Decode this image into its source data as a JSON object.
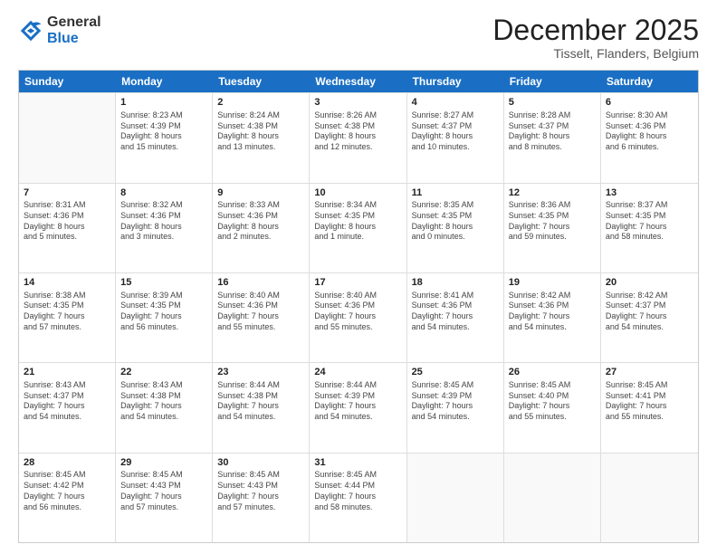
{
  "logo": {
    "general": "General",
    "blue": "Blue"
  },
  "header": {
    "month": "December 2025",
    "location": "Tisselt, Flanders, Belgium"
  },
  "days": [
    "Sunday",
    "Monday",
    "Tuesday",
    "Wednesday",
    "Thursday",
    "Friday",
    "Saturday"
  ],
  "weeks": [
    [
      {
        "day": "",
        "info": ""
      },
      {
        "day": "1",
        "info": "Sunrise: 8:23 AM\nSunset: 4:39 PM\nDaylight: 8 hours\nand 15 minutes."
      },
      {
        "day": "2",
        "info": "Sunrise: 8:24 AM\nSunset: 4:38 PM\nDaylight: 8 hours\nand 13 minutes."
      },
      {
        "day": "3",
        "info": "Sunrise: 8:26 AM\nSunset: 4:38 PM\nDaylight: 8 hours\nand 12 minutes."
      },
      {
        "day": "4",
        "info": "Sunrise: 8:27 AM\nSunset: 4:37 PM\nDaylight: 8 hours\nand 10 minutes."
      },
      {
        "day": "5",
        "info": "Sunrise: 8:28 AM\nSunset: 4:37 PM\nDaylight: 8 hours\nand 8 minutes."
      },
      {
        "day": "6",
        "info": "Sunrise: 8:30 AM\nSunset: 4:36 PM\nDaylight: 8 hours\nand 6 minutes."
      }
    ],
    [
      {
        "day": "7",
        "info": "Sunrise: 8:31 AM\nSunset: 4:36 PM\nDaylight: 8 hours\nand 5 minutes."
      },
      {
        "day": "8",
        "info": "Sunrise: 8:32 AM\nSunset: 4:36 PM\nDaylight: 8 hours\nand 3 minutes."
      },
      {
        "day": "9",
        "info": "Sunrise: 8:33 AM\nSunset: 4:36 PM\nDaylight: 8 hours\nand 2 minutes."
      },
      {
        "day": "10",
        "info": "Sunrise: 8:34 AM\nSunset: 4:35 PM\nDaylight: 8 hours\nand 1 minute."
      },
      {
        "day": "11",
        "info": "Sunrise: 8:35 AM\nSunset: 4:35 PM\nDaylight: 8 hours\nand 0 minutes."
      },
      {
        "day": "12",
        "info": "Sunrise: 8:36 AM\nSunset: 4:35 PM\nDaylight: 7 hours\nand 59 minutes."
      },
      {
        "day": "13",
        "info": "Sunrise: 8:37 AM\nSunset: 4:35 PM\nDaylight: 7 hours\nand 58 minutes."
      }
    ],
    [
      {
        "day": "14",
        "info": "Sunrise: 8:38 AM\nSunset: 4:35 PM\nDaylight: 7 hours\nand 57 minutes."
      },
      {
        "day": "15",
        "info": "Sunrise: 8:39 AM\nSunset: 4:35 PM\nDaylight: 7 hours\nand 56 minutes."
      },
      {
        "day": "16",
        "info": "Sunrise: 8:40 AM\nSunset: 4:36 PM\nDaylight: 7 hours\nand 55 minutes."
      },
      {
        "day": "17",
        "info": "Sunrise: 8:40 AM\nSunset: 4:36 PM\nDaylight: 7 hours\nand 55 minutes."
      },
      {
        "day": "18",
        "info": "Sunrise: 8:41 AM\nSunset: 4:36 PM\nDaylight: 7 hours\nand 54 minutes."
      },
      {
        "day": "19",
        "info": "Sunrise: 8:42 AM\nSunset: 4:36 PM\nDaylight: 7 hours\nand 54 minutes."
      },
      {
        "day": "20",
        "info": "Sunrise: 8:42 AM\nSunset: 4:37 PM\nDaylight: 7 hours\nand 54 minutes."
      }
    ],
    [
      {
        "day": "21",
        "info": "Sunrise: 8:43 AM\nSunset: 4:37 PM\nDaylight: 7 hours\nand 54 minutes."
      },
      {
        "day": "22",
        "info": "Sunrise: 8:43 AM\nSunset: 4:38 PM\nDaylight: 7 hours\nand 54 minutes."
      },
      {
        "day": "23",
        "info": "Sunrise: 8:44 AM\nSunset: 4:38 PM\nDaylight: 7 hours\nand 54 minutes."
      },
      {
        "day": "24",
        "info": "Sunrise: 8:44 AM\nSunset: 4:39 PM\nDaylight: 7 hours\nand 54 minutes."
      },
      {
        "day": "25",
        "info": "Sunrise: 8:45 AM\nSunset: 4:39 PM\nDaylight: 7 hours\nand 54 minutes."
      },
      {
        "day": "26",
        "info": "Sunrise: 8:45 AM\nSunset: 4:40 PM\nDaylight: 7 hours\nand 55 minutes."
      },
      {
        "day": "27",
        "info": "Sunrise: 8:45 AM\nSunset: 4:41 PM\nDaylight: 7 hours\nand 55 minutes."
      }
    ],
    [
      {
        "day": "28",
        "info": "Sunrise: 8:45 AM\nSunset: 4:42 PM\nDaylight: 7 hours\nand 56 minutes."
      },
      {
        "day": "29",
        "info": "Sunrise: 8:45 AM\nSunset: 4:43 PM\nDaylight: 7 hours\nand 57 minutes."
      },
      {
        "day": "30",
        "info": "Sunrise: 8:45 AM\nSunset: 4:43 PM\nDaylight: 7 hours\nand 57 minutes."
      },
      {
        "day": "31",
        "info": "Sunrise: 8:45 AM\nSunset: 4:44 PM\nDaylight: 7 hours\nand 58 minutes."
      },
      {
        "day": "",
        "info": ""
      },
      {
        "day": "",
        "info": ""
      },
      {
        "day": "",
        "info": ""
      }
    ]
  ]
}
